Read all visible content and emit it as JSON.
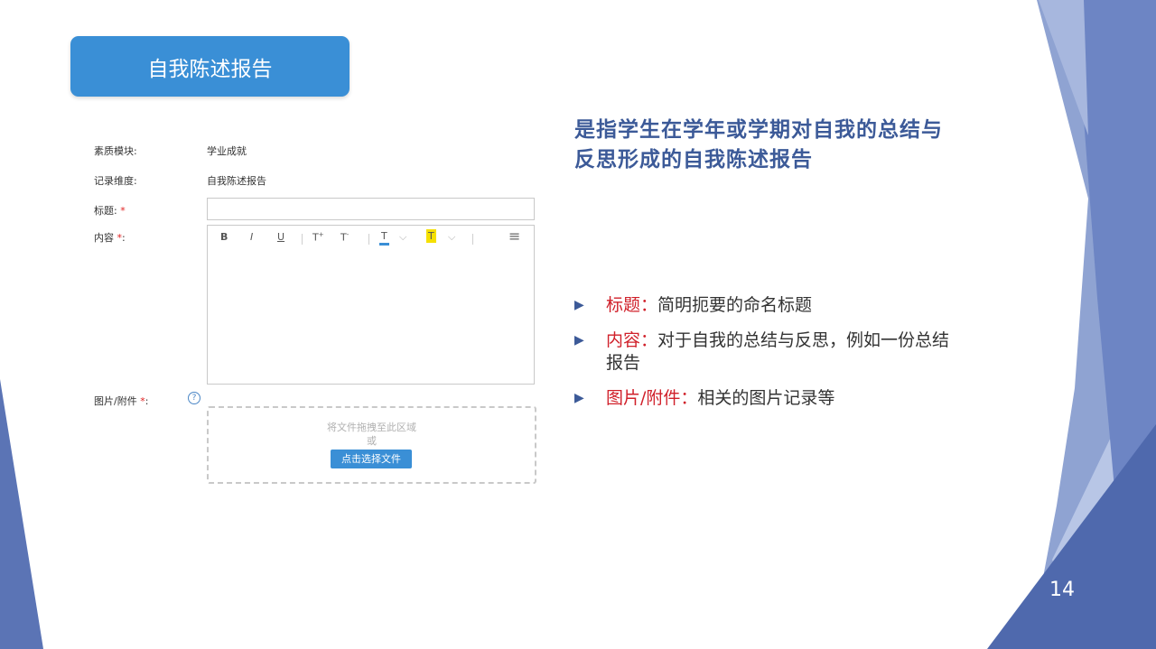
{
  "slide": {
    "title": "自我陈述报告",
    "page_number": "14",
    "accent_color": "#3a8fd6",
    "heading_color": "#3c5a98",
    "key_color": "#d0202a"
  },
  "form": {
    "module_label": "素质模块:",
    "module_value": "学业成就",
    "dimension_label": "记录维度:",
    "dimension_value": "自我陈述报告",
    "title_label": "标题:",
    "content_label": "内容",
    "attachment_label": "图片/附件",
    "required_mark": "*",
    "colon": ":",
    "help_icon": "?",
    "title_value": "",
    "drop_hint_line1": "将文件拖拽至此区域",
    "drop_hint_line2": "或",
    "upload_button": "点击选择文件"
  },
  "toolbar": {
    "bold": "B",
    "italic": "I",
    "underline": "U",
    "font_size_up": "T",
    "font_size_down": "T",
    "text_color": "T",
    "highlight": "T",
    "chevron": "⌵",
    "menu": "≡",
    "highlight_color": "#f5e000",
    "text_color_bar": "#3a8fd6"
  },
  "description": "是指学生在学年或学期对自我的总结与反思形成的自我陈述报告",
  "bullets": [
    {
      "key": "标题：",
      "text": "简明扼要的命名标题"
    },
    {
      "key": "内容：",
      "text": "对于自我的总结与反思，例如一份总结报告"
    },
    {
      "key": "图片/附件：",
      "text": "相关的图片记录等"
    }
  ],
  "bullet_marker": "▶"
}
